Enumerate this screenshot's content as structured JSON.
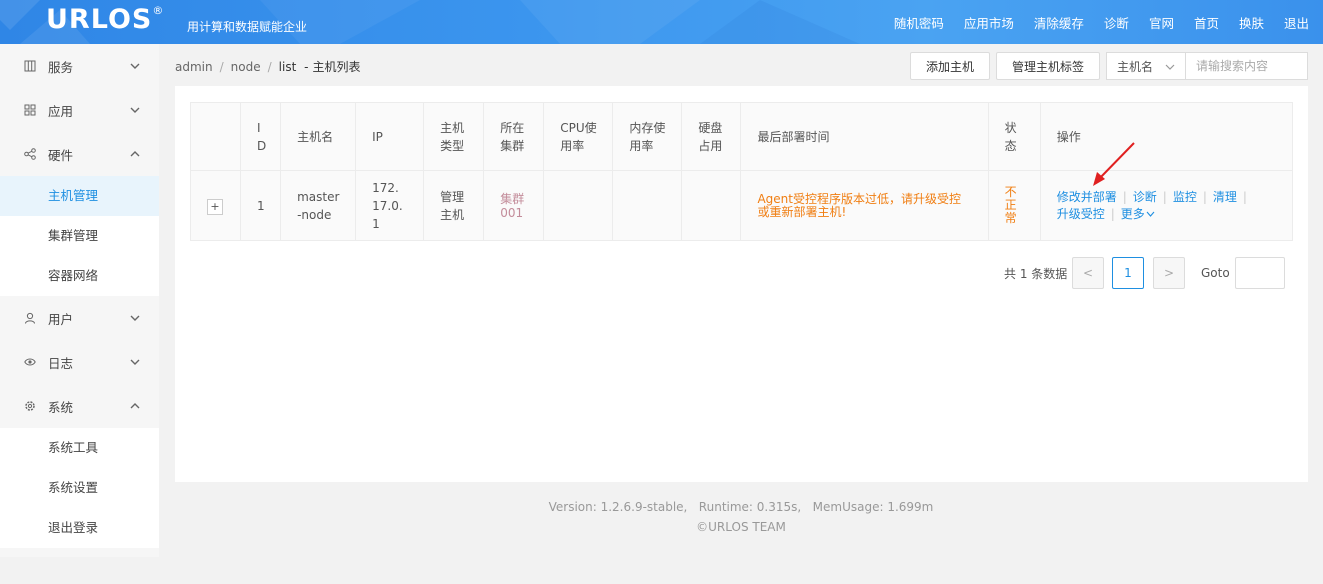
{
  "header": {
    "logo": "URLOS",
    "logo_mark": "®",
    "slogan": "用计算和数据赋能企业",
    "nav": [
      "随机密码",
      "应用市场",
      "清除缓存",
      "诊断",
      "官网",
      "首页",
      "换肤",
      "退出"
    ]
  },
  "sidebar": {
    "groups": [
      {
        "label": "服务",
        "icon": "grid-icon",
        "expanded": false
      },
      {
        "label": "应用",
        "icon": "apps-icon",
        "expanded": false
      },
      {
        "label": "硬件",
        "icon": "share-icon",
        "expanded": true,
        "items": [
          "主机管理",
          "集群管理",
          "容器网络"
        ],
        "active": "主机管理"
      },
      {
        "label": "用户",
        "icon": "user-icon",
        "expanded": false
      },
      {
        "label": "日志",
        "icon": "eye-icon",
        "expanded": false
      },
      {
        "label": "系统",
        "icon": "gear-icon",
        "expanded": true,
        "items": [
          "系统工具",
          "系统设置",
          "退出登录"
        ]
      }
    ]
  },
  "breadcrumb": {
    "parts": [
      "admin",
      "node",
      "list"
    ],
    "current": "主机列表",
    "dash": "-"
  },
  "toolbar": {
    "add_host": "添加主机",
    "manage_tags": "管理主机标签",
    "filter_select": "主机名",
    "search_placeholder": "请输搜索内容"
  },
  "table": {
    "columns": [
      "",
      "ID",
      "主机名",
      "IP",
      "主机类型",
      "所在集群",
      "CPU使用率",
      "内存使用率",
      "硬盘占用",
      "最后部署时间",
      "状态",
      "操作"
    ],
    "rows": [
      {
        "expand": "+",
        "id": "1",
        "hostname": "master-node",
        "ip": "172.17.0.1",
        "type": "管理主机",
        "cluster": "集群001",
        "cpu": "",
        "mem": "",
        "disk": "",
        "last_deploy": "Agent受控程序版本过低，请升级受控或重新部署主机!",
        "status": "不正常",
        "actions": [
          "修改并部署",
          "诊断",
          "监控",
          "清理",
          "升级受控",
          "更多"
        ]
      }
    ]
  },
  "pagination": {
    "total_text": "共 1 条数据",
    "prev": "<",
    "current": "1",
    "next": ">",
    "goto_label": "Goto"
  },
  "footer": {
    "line1": "Version: 1.2.6.9-stable,   Runtime: 0.315s,   MemUsage: 1.699m",
    "line2": "©URLOS TEAM"
  },
  "colors": {
    "header_blue": "#3b95ee",
    "link_blue": "#1e8fe1",
    "warning_orange": "#f07e12",
    "active_bg": "#e8f4fc",
    "arrow_red": "#e02020"
  }
}
